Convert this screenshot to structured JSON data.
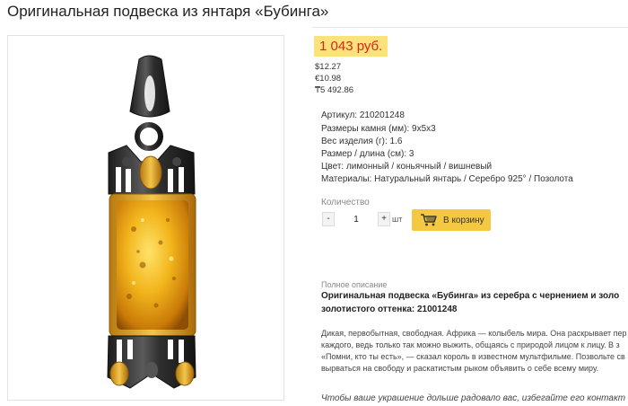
{
  "product": {
    "title": "Оригинальная подвеска из янтаря «Бубинга»",
    "image_alt": "pendant-photo"
  },
  "price": {
    "main": "1 043 руб.",
    "usd": "$12.27",
    "eur": "€10.98",
    "kzt": "₸5 492.86"
  },
  "specs": [
    "Артикул: 210201248",
    "Размеры камня (мм): 9х5х3",
    "Вес изделия (г): 1.6",
    "Размер / длина (см): 3",
    "Цвет: лимонный / коньячный / вишневый",
    "Материалы: Натуральный янтарь / Серебро 925° / Позолота"
  ],
  "purchase": {
    "quantity_label": "Количество",
    "minus": "-",
    "plus": "+",
    "quantity_value": "1",
    "unit": "шт",
    "cart_button": "В корзину"
  },
  "description": {
    "label": "Полное описание",
    "title_line1": "Оригинальная подвеска «Бубинга» из серебра с чернением и золо",
    "title_line2": "золотистого оттенка: 21001248",
    "text_lines": [
      "Дикая, первобытная, свободная. Африка — колыбель мира. Она раскрывает пер",
      "каждого, ведь только так можно выжить, общаясь с природой лицом к лицу. В з",
      "«Помни, кто ты есть», — сказал король в известном мультфильме. Позвольте св",
      "вырваться на свободу и раскатистым рыком объявить о себе всему миру."
    ],
    "italic_line": "Чтобы ваше украшение дольше радовало вас, избегайте его контакт"
  },
  "colors": {
    "price_bg": "#fbe27a",
    "price_text": "#d9251c",
    "cart_bg": "#f5c842",
    "amber": "#e8a613",
    "gold": "#d9a21a",
    "blackened_silver": "#2a2a2a"
  },
  "icons": {
    "cart": "shopping-cart-icon"
  }
}
